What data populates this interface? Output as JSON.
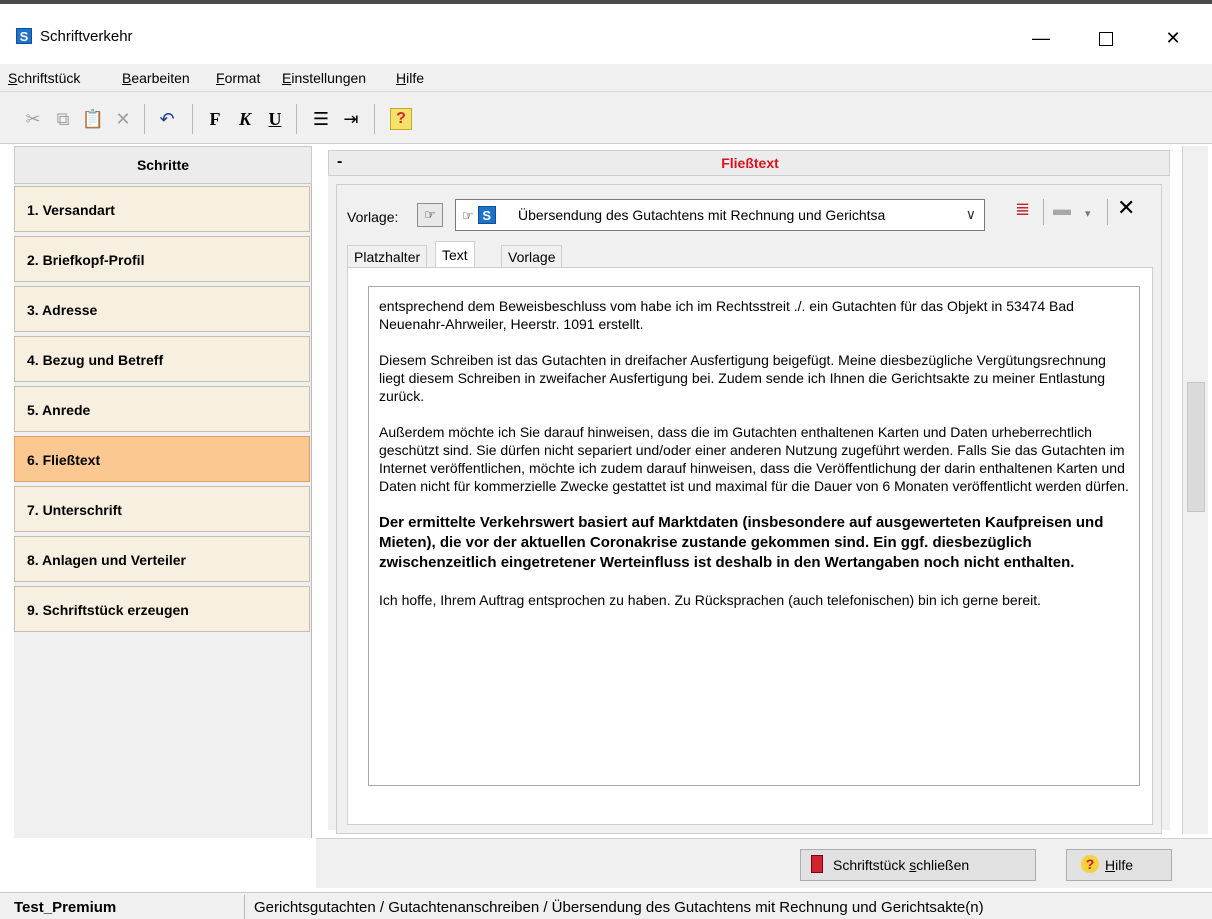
{
  "window": {
    "app_icon_letter": "S",
    "title": "Schriftverkehr",
    "minimize": "—",
    "close": "✕"
  },
  "menu": [
    {
      "first": "S",
      "rest": "chriftstück"
    },
    {
      "first": "B",
      "rest": "earbeiten"
    },
    {
      "first": "F",
      "rest": "ormat"
    },
    {
      "first": "E",
      "rest": "instellungen"
    },
    {
      "first": "H",
      "rest": "ilfe"
    }
  ],
  "toolbar": {
    "cut_icon": "✂",
    "copy_icon": "⧉",
    "paste_icon": "📋",
    "delete_icon": "✕",
    "undo_icon": "↶",
    "bold": "F",
    "italic": "K",
    "underline": "U",
    "list_icon": "☰",
    "indent_icon": "⇥",
    "help_icon": "?"
  },
  "steps": {
    "header": "Schritte",
    "items": [
      {
        "label": "1. Versandart",
        "active": false
      },
      {
        "label": "2. Briefkopf-Profil",
        "active": false
      },
      {
        "label": "3. Adresse",
        "active": false
      },
      {
        "label": "4. Bezug und Betreff",
        "active": false
      },
      {
        "label": "5. Anrede",
        "active": false
      },
      {
        "label": "6. Fließtext",
        "active": true
      },
      {
        "label": "7. Unterschrift",
        "active": false
      },
      {
        "label": "8. Anlagen und Verteiler",
        "active": false
      },
      {
        "label": "9. Schriftstück erzeugen",
        "active": false
      }
    ]
  },
  "section": {
    "collapse": "-",
    "title": "Fließtext"
  },
  "vorlage": {
    "label": "Vorlage:",
    "pointer_icon": "☞",
    "selected_letter": "S",
    "selected": "Übersendung des Gutachtens mit Rechnung und Gerichtsa",
    "arrow": "∨",
    "format_icon": "≣",
    "save_icon": "▬",
    "dropdown_icon": "▾",
    "close_icon": "✕"
  },
  "tabs": [
    "Platzhalter",
    "Text",
    "Vorlage"
  ],
  "editor": {
    "paragraphs": [
      "entsprechend dem Beweisbeschluss vom habe ich im Rechtsstreit ./. ein Gutachten für das Objekt in 53474 Bad Neuenahr-Ahrweiler, Heerstr. 1091 erstellt.",
      "Diesem Schreiben ist das Gutachten in dreifacher Ausfertigung beigefügt. Meine diesbezügliche Vergütungsrechnung liegt diesem Schreiben in zweifacher Ausfertigung bei. Zudem sende ich Ihnen die Gerichtsakte zu meiner Entlastung zurück.",
      "Außerdem möchte ich Sie darauf hinweisen, dass die im Gutachten enthaltenen Karten und Daten urheberrechtlich geschützt sind. Sie dürfen nicht separiert und/oder einer anderen Nutzung zugeführt werden. Falls Sie das Gutachten im Internet veröffentlichen, möchte ich zudem darauf hinweisen, dass die Veröffentlichung der darin enthaltenen Karten und Daten nicht für kommerzielle Zwecke gestattet ist und maximal für die Dauer von 6 Monaten veröffentlicht werden dürfen.",
      "Der ermittelte Verkehrswert basiert auf Marktdaten (insbesondere auf ausgewerteten Kaufpreisen und Mieten), die vor der aktuellen Coronakrise zustande gekommen sind. Ein ggf. diesbezüglich zwischenzeitlich eingetretener Werteinfluss ist deshalb in den Wertangaben noch nicht enthalten.",
      "Ich hoffe, Ihrem Auftrag entsprochen zu haben. Zu Rücksprachen (auch telefonischen) bin ich gerne bereit."
    ]
  },
  "buttons": {
    "close_doc_pre": "Schriftstück ",
    "close_doc_u": "s",
    "close_doc_post": "chließen",
    "help_u": "H",
    "help_post": "ilfe",
    "help_icon": "?"
  },
  "status": {
    "left": "Test_Premium",
    "right": "Gerichtsgutachten / Gutachtenanschreiben / Übersendung des Gutachtens mit Rechnung und Gerichtsakte(n)"
  }
}
